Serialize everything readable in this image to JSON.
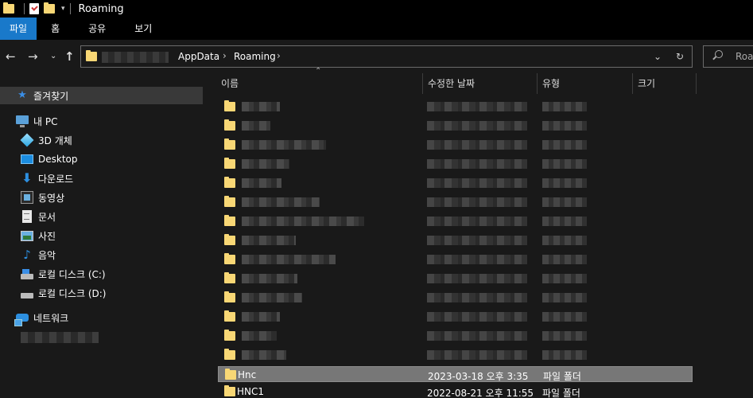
{
  "window": {
    "title": "Roaming"
  },
  "ribbon": {
    "tabs": [
      "파일",
      "홈",
      "공유",
      "보기"
    ]
  },
  "address": {
    "crumbs": [
      "AppData",
      "Roaming"
    ],
    "search_placeholder": "Roam"
  },
  "nav": {
    "quick_access": "즐겨찾기",
    "this_pc": "내 PC",
    "items": [
      "3D 개체",
      "Desktop",
      "다운로드",
      "동영상",
      "문서",
      "사진",
      "음악",
      "로컬 디스크 (C:)",
      "로컬 디스크 (D:)"
    ],
    "network": "네트워크"
  },
  "columns": {
    "name": "이름",
    "date": "수정한 날짜",
    "type": "유형",
    "size": "크기"
  },
  "files": [
    {
      "name": "Hnc",
      "date": "2023-03-18 오후 3:35",
      "type": "파일 폴더"
    },
    {
      "name": "HNC1",
      "date": "2022-08-21 오후 11:55",
      "type": "파일 폴더"
    }
  ],
  "colors": {
    "accent": "#1979ca",
    "folder": "#f8d775",
    "selection": "#777777"
  }
}
